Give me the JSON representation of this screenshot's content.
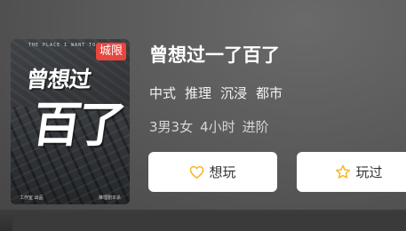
{
  "cover": {
    "badge": "城限",
    "title_line1": "曾想过",
    "title_line2": "百了",
    "top_text": "THE PLACE I WANT TO GO",
    "bottom_left": "工作室 出品",
    "bottom_right": "推理剧本杀"
  },
  "game": {
    "title": "曾想过一了百了",
    "tags": [
      "中式",
      "推理",
      "沉浸",
      "都市"
    ],
    "meta": [
      "3男3女",
      "4小时",
      "进阶"
    ]
  },
  "buttons": {
    "want_label": "想玩",
    "played_label": "玩过"
  },
  "colors": {
    "badge": "#e8463f",
    "icon_accent": "#f5b82e",
    "button_bg": "#ffffff"
  },
  "icons": {
    "want": "heart-icon",
    "played": "star-icon"
  }
}
